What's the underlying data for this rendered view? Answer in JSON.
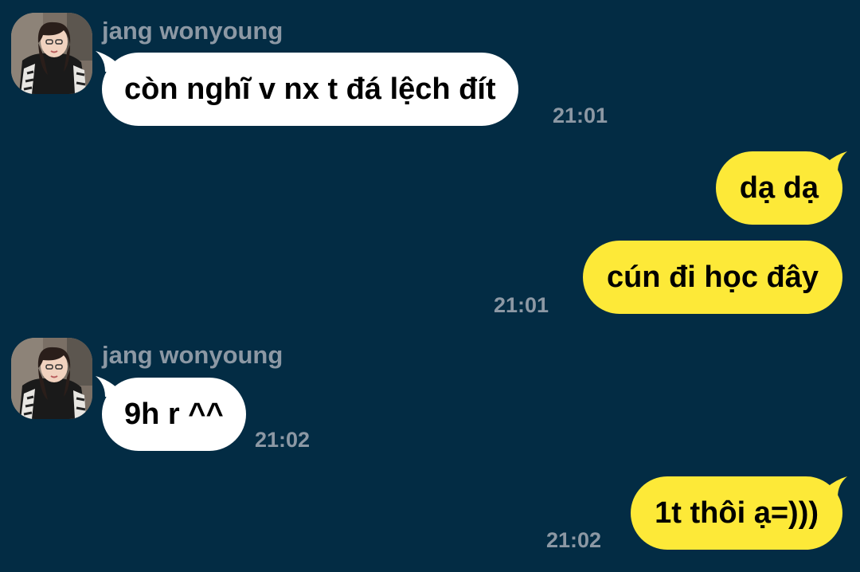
{
  "chat": {
    "messages": [
      {
        "direction": "incoming",
        "sender": "jang wonyoung",
        "text": "còn nghĩ v nx t đá lệch đít",
        "time": "21:01"
      },
      {
        "direction": "outgoing",
        "text": "dạ dạ",
        "time": ""
      },
      {
        "direction": "outgoing",
        "text": "cún đi học đây",
        "time": "21:01"
      },
      {
        "direction": "incoming",
        "sender": "jang wonyoung",
        "text": "9h r ^^",
        "time": "21:02"
      },
      {
        "direction": "outgoing",
        "text": "1t thôi ạ=)))",
        "time": "21:02"
      }
    ]
  },
  "colors": {
    "background": "#032c44",
    "incoming_bubble": "#ffffff",
    "outgoing_bubble": "#fde938",
    "meta_text": "#8c98a4"
  },
  "icons": {
    "avatar": "profile-photo-icon"
  }
}
